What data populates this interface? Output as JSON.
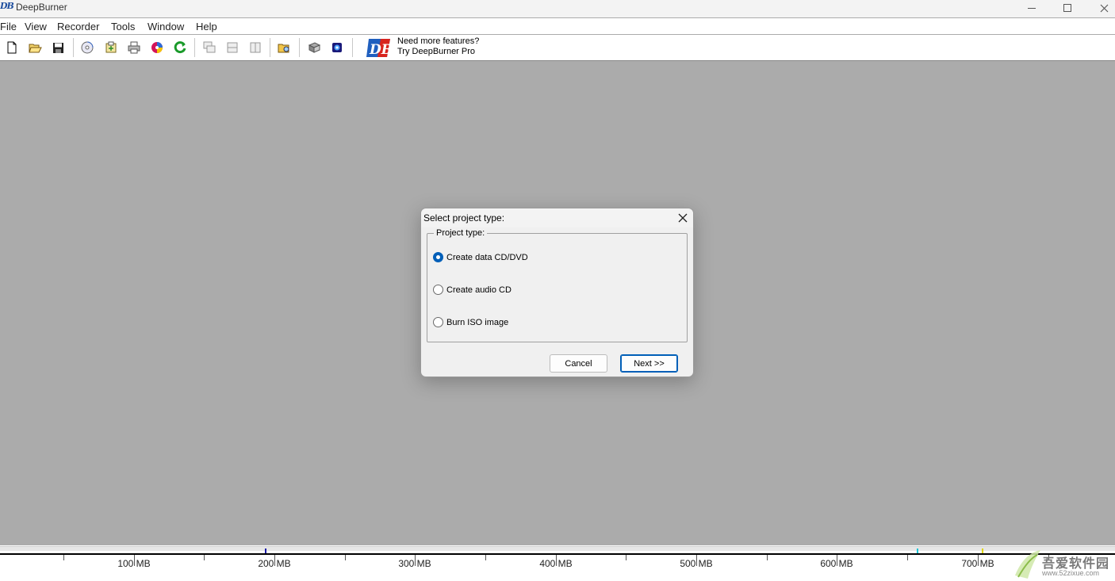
{
  "window": {
    "title": "DeepBurner",
    "logo_text": "DB"
  },
  "menu": [
    "File",
    "View",
    "Recorder",
    "Tools",
    "Window",
    "Help"
  ],
  "toolbar": {
    "buttons": [
      {
        "name": "new-icon"
      },
      {
        "name": "open-icon"
      },
      {
        "name": "save-icon"
      },
      {
        "name": "burn-disc-icon"
      },
      {
        "name": "add-files-icon"
      },
      {
        "name": "print-icon"
      },
      {
        "name": "disc-label-icon"
      },
      {
        "name": "refresh-icon"
      },
      {
        "name": "cascade-icon"
      },
      {
        "name": "tile-horizontal-icon"
      },
      {
        "name": "tile-vertical-icon"
      },
      {
        "name": "explorer-icon"
      },
      {
        "name": "manual-icon"
      },
      {
        "name": "about-icon"
      }
    ],
    "promo_logo": "DB",
    "promo_line1": "Need more features?",
    "promo_line2": "Try DeepBurner Pro"
  },
  "dialog": {
    "title": "Select project type:",
    "group_label": "Project type:",
    "options": [
      {
        "label": "Create data CD/DVD",
        "checked": true
      },
      {
        "label": "Create audio CD",
        "checked": false
      },
      {
        "label": "Burn ISO image",
        "checked": false
      }
    ],
    "cancel_label": "Cancel",
    "next_label": "Next >>"
  },
  "capacity": {
    "labels": [
      "100 MB",
      "200 MB",
      "300 MB",
      "400 MB",
      "500 MB",
      "600 MB",
      "700 MB"
    ],
    "marker_colors": [
      "#1a1aa8",
      "#19c3d6",
      "#e0d400"
    ]
  },
  "watermark": {
    "text": "吾爱软件园",
    "url": "www.52zixue.com"
  }
}
